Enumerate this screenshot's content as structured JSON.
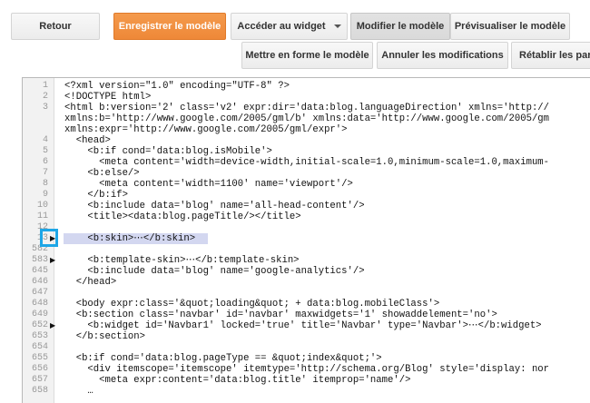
{
  "toolbar": {
    "back": "Retour",
    "save_template": "Enregistrer le modèle",
    "jump_to_widget": "Accéder au widget",
    "edit_template": "Modifier le modèle",
    "preview_template": "Prévisualiser le modèle",
    "format_template": "Mettre en forme le modèle",
    "revert_changes": "Annuler les modifications",
    "restore_widgets": "Rétablir les para"
  },
  "colors": {
    "accent": "#ee8838",
    "marker": "#1ea6e6",
    "highlight": "#d3d7f0"
  },
  "editor": {
    "lines": [
      {
        "no": "1",
        "text": "<?xml version=\"1.0\" encoding=\"UTF-8\" ?>"
      },
      {
        "no": "2",
        "text": "<!DOCTYPE html>"
      },
      {
        "no": "3",
        "text": "<html b:version='2' class='v2' expr:dir='data:blog.languageDirection' xmlns='http://"
      },
      {
        "no": "",
        "text": "xmlns:b='http://www.google.com/2005/gml/b' xmlns:data='http://www.google.com/2005/gm"
      },
      {
        "no": "",
        "text": "xmlns:expr='http://www.google.com/2005/gml/expr'>"
      },
      {
        "no": "4",
        "text": "  <head>"
      },
      {
        "no": "5",
        "text": "    <b:if cond='data:blog.isMobile'>"
      },
      {
        "no": "6",
        "text": "      <meta content='width=device-width,initial-scale=1.0,minimum-scale=1.0,maximum-"
      },
      {
        "no": "7",
        "text": "    <b:else/>"
      },
      {
        "no": "8",
        "text": "      <meta content='width=1100' name='viewport'/>"
      },
      {
        "no": "9",
        "text": "    </b:if>"
      },
      {
        "no": "10",
        "text": "    <b:include data='blog' name='all-head-content'/>"
      },
      {
        "no": "11",
        "text": "    <title><data:blog.pageTitle/></title>"
      },
      {
        "no": "12",
        "text": ""
      },
      {
        "no": "13",
        "text": "    <b:skin>⋯</b:skin>",
        "arrow": true,
        "highlight": true
      },
      {
        "no": "582",
        "text": ""
      },
      {
        "no": "583",
        "text": "    <b:template-skin>⋯</b:template-skin>",
        "arrow": true
      },
      {
        "no": "645",
        "text": "    <b:include data='blog' name='google-analytics'/>"
      },
      {
        "no": "646",
        "text": "  </head>"
      },
      {
        "no": "647",
        "text": ""
      },
      {
        "no": "648",
        "text": "  <body expr:class='&quot;loading&quot; + data:blog.mobileClass'>"
      },
      {
        "no": "649",
        "text": "  <b:section class='navbar' id='navbar' maxwidgets='1' showaddelement='no'>"
      },
      {
        "no": "652",
        "text": "    <b:widget id='Navbar1' locked='true' title='Navbar' type='Navbar'>⋯</b:widget>",
        "arrow": true
      },
      {
        "no": "653",
        "text": "  </b:section>"
      },
      {
        "no": "654",
        "text": ""
      },
      {
        "no": "655",
        "text": "  <b:if cond='data:blog.pageType == &quot;index&quot;'>"
      },
      {
        "no": "656",
        "text": "    <div itemscope='itemscope' itemtype='http://schema.org/Blog' style='display: nor"
      },
      {
        "no": "657",
        "text": "      <meta expr:content='data:blog.title' itemprop='name'/>"
      },
      {
        "no": "658",
        "text": "    …"
      }
    ]
  }
}
